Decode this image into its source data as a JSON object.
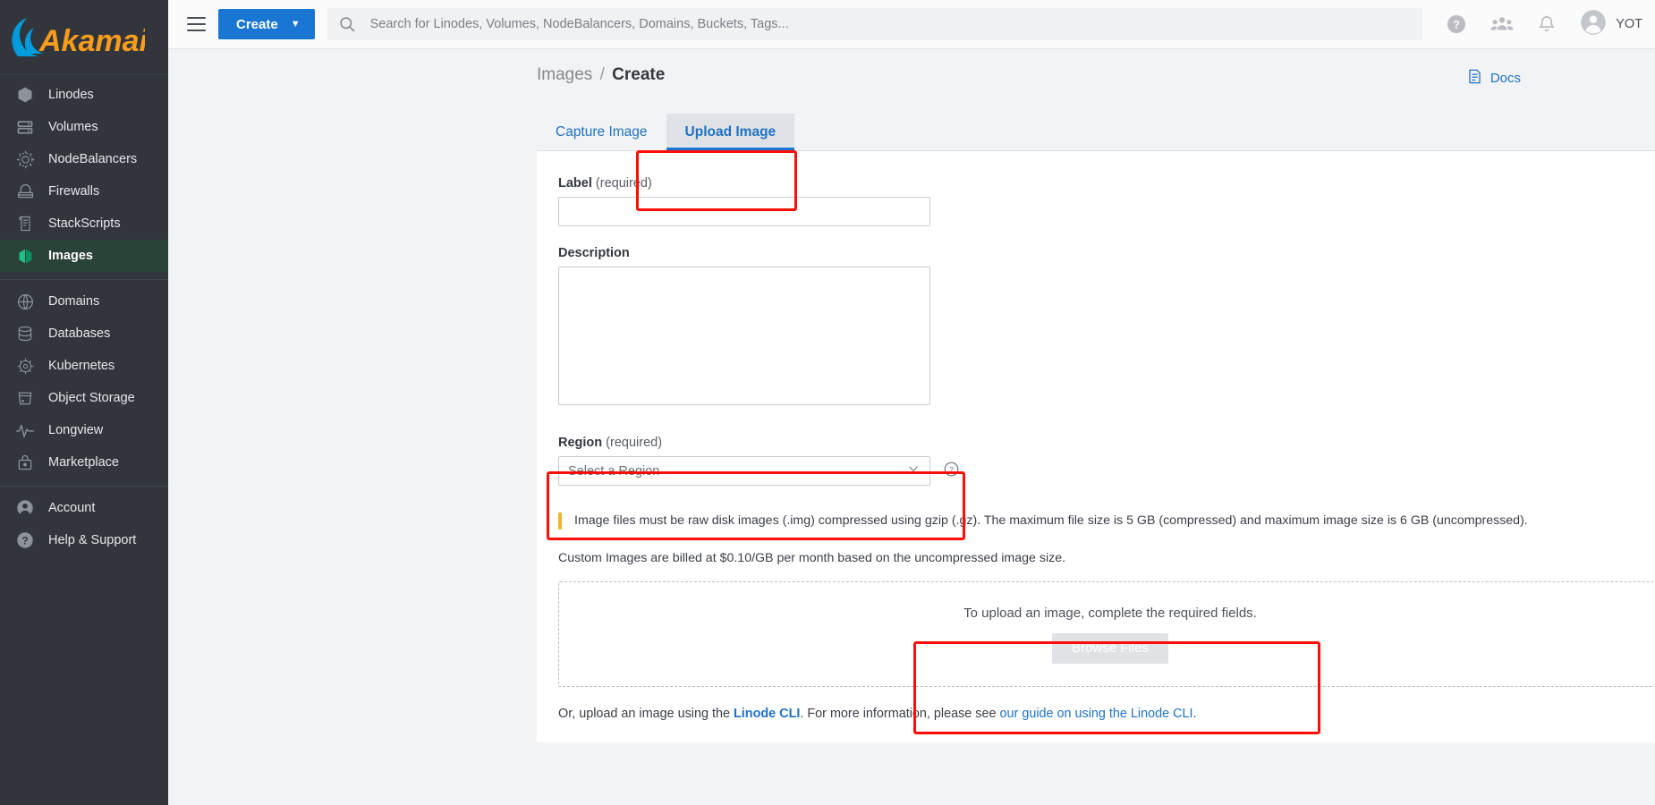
{
  "brand": {
    "logo_text": "Akamai",
    "logo_color": "#f89c1c",
    "logo_arc_color": "#009cde"
  },
  "colors": {
    "sidebar_bg": "#32363c",
    "active_item_bg": "#2a4339",
    "primary_blue": "#1976d2",
    "link_blue": "#1e72c4",
    "notice_accent": "#f0b429",
    "annotation_red": "#fb0f08"
  },
  "topbar": {
    "menu_icon": "hamburger-icon",
    "create_label": "Create",
    "create_caret": "⌄",
    "search": {
      "icon": "search-icon",
      "placeholder": "Search for Linodes, Volumes, NodeBalancers, Domains, Buckets, Tags...",
      "value": ""
    },
    "actions": [
      {
        "name": "help-icon",
        "title": "Help"
      },
      {
        "name": "community-icon",
        "title": "Community"
      },
      {
        "name": "notifications-bell-icon",
        "title": "Notifications"
      }
    ],
    "user": {
      "avatar": "user-avatar-icon",
      "username": "YOT"
    }
  },
  "sidebar": {
    "primary_items": [
      {
        "label": "Linodes",
        "icon": "linode-cube-icon",
        "active": false
      },
      {
        "label": "Volumes",
        "icon": "volumes-icon",
        "active": false
      },
      {
        "label": "NodeBalancers",
        "icon": "nodebalancers-icon",
        "active": false
      },
      {
        "label": "Firewalls",
        "icon": "firewall-icon",
        "active": false
      },
      {
        "label": "StackScripts",
        "icon": "stackscripts-icon",
        "active": false
      },
      {
        "label": "Images",
        "icon": "images-icon",
        "active": true
      }
    ],
    "secondary_items": [
      {
        "label": "Domains",
        "icon": "globe-icon",
        "active": false
      },
      {
        "label": "Databases",
        "icon": "database-icon",
        "active": false
      },
      {
        "label": "Kubernetes",
        "icon": "kubernetes-helm-icon",
        "active": false
      },
      {
        "label": "Object Storage",
        "icon": "bucket-icon",
        "active": false
      },
      {
        "label": "Longview",
        "icon": "pulse-icon",
        "active": false
      },
      {
        "label": "Marketplace",
        "icon": "marketplace-bag-icon",
        "active": false
      }
    ],
    "footer_items": [
      {
        "label": "Account",
        "icon": "account-person-icon",
        "active": false
      },
      {
        "label": "Help & Support",
        "icon": "help-question-icon",
        "active": false
      }
    ]
  },
  "page": {
    "breadcrumb_parent": "Images",
    "breadcrumb_separator": "/",
    "breadcrumb_current": "Create",
    "docs_label": "Docs",
    "docs_icon": "docs-document-icon"
  },
  "tabs": [
    {
      "label": "Capture Image",
      "active": false
    },
    {
      "label": "Upload Image",
      "active": true
    }
  ],
  "form": {
    "label_field": {
      "label": "Label",
      "required_text": "(required)",
      "value": "",
      "placeholder": ""
    },
    "description_field": {
      "label": "Description",
      "required_text": "",
      "value": "",
      "placeholder": ""
    },
    "region_field": {
      "label": "Region",
      "required_text": "(required)",
      "selected": "Select a Region",
      "caret_icon": "chevron-down-icon",
      "help_icon": "help-circle-icon"
    }
  },
  "notices": {
    "file_requirements": "Image files must be raw disk images (.img) compressed using gzip (.gz). The maximum file size is 5 GB (compressed) and maximum image size is 6 GB (uncompressed).",
    "billing": "Custom Images are billed at $0.10/GB per month based on the uncompressed image size."
  },
  "dropzone": {
    "message": "To upload an image, complete the required fields.",
    "button_label": "Browse Files",
    "button_disabled": true
  },
  "cli_note": {
    "prefix": "Or, upload an image using the ",
    "link1": "Linode CLI",
    "middle": ". For more information, please see ",
    "link2": "our guide on using the Linode CLI",
    "suffix": "."
  },
  "annotations": [
    {
      "name": "annotation-upload-image-tab",
      "target": "Upload Image tab"
    },
    {
      "name": "annotation-region-field",
      "target": "Region (required) select"
    },
    {
      "name": "annotation-browse-files",
      "target": "Browse Files dropzone area"
    }
  ]
}
